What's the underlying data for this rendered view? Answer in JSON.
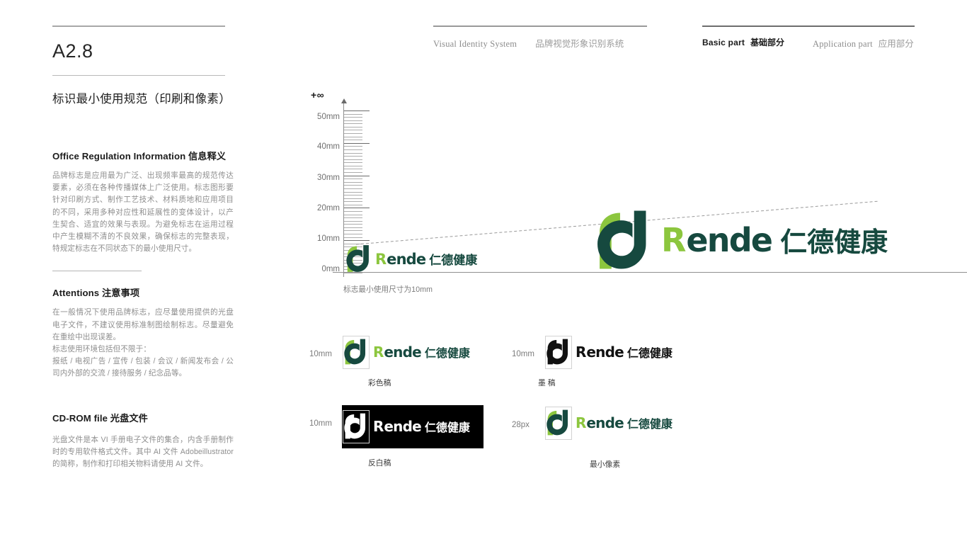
{
  "header": {
    "left_en": "Visual Identity System",
    "left_cn": "品牌视觉形象识别系统",
    "right_en_active": "Basic part",
    "right_cn_active": "基础部分",
    "right_en_inactive": "Application part",
    "right_cn_inactive": "应用部分"
  },
  "page": {
    "code": "A2.8",
    "subtitle": "标识最小使用规范（印刷和像素）"
  },
  "sections": [
    {
      "heading": "Office Regulation Information 信息释义",
      "body": "品牌标志是应用最为广泛、出现频率最高的规范传达要素，必须在各种传播媒体上广泛使用。标志图形要针对印刷方式、制作工艺技术、材料质地和应用项目的不同，采用多种对应性和延展性的变体设计，以产生契合、适宜的效果与表现。为避免标志在运用过程中产生模糊不清的不良效果，确保标志的完整表现，特规定标志在不同状态下的最小使用尺寸。"
    },
    {
      "heading": "Attentions 注意事项",
      "body": "在一般情况下使用品牌标志，应尽量使用提供的光盘电子文件，不建议使用标准制图绘制标志。尽量避免在重绘中出现误差。\n标志使用环境包括但不限于：\n报纸 / 电视广告 / 宣传 / 包装 / 会议 / 新闻发布会 / 公司内外部的交流 / 接待服务 / 纪念品等。"
    },
    {
      "heading": "CD-ROM file 光盘文件",
      "body": "光盘文件是本 VI 手册电子文件的集合，内含手册制作时的专用软件格式文件。其中 AI 文件 Adobeillustrator 的简称，制作和打印相关物料请使用 AI 文件。"
    }
  ],
  "chart_data": {
    "type": "scatter",
    "title": "",
    "xlabel": "+∞",
    "ylabel": "+∞",
    "y_ticks": [
      "50mm",
      "40mm",
      "30mm",
      "20mm",
      "10mm",
      "0mm"
    ],
    "y_tick_values": [
      50,
      40,
      30,
      20,
      10,
      0
    ],
    "ylim": [
      0,
      50
    ],
    "unit": "mm",
    "ruler_major_interval_mm": 10,
    "ruler_minor_interval_mm": 1,
    "axis_top_label": "+∞",
    "axis_right_label": "+∞",
    "caption": "标志最小使用尺寸为10mm",
    "series": [
      {
        "name": "minimum-size-logo",
        "size_mm": 10,
        "x": 0.06
      },
      {
        "name": "scaled-logo",
        "size_mm": 25,
        "x": 0.62
      }
    ],
    "grid": false,
    "legend": "none"
  },
  "logo": {
    "word_r": "R",
    "word_rest": "ende",
    "word_cn": "仁德健康",
    "color_light": "#8cc63e",
    "color_dark": "#16493f",
    "color_black": "#111111",
    "color_white": "#ffffff"
  },
  "samples": [
    {
      "size_label": "10mm",
      "caption": "彩色稿",
      "variant": "color"
    },
    {
      "size_label": "10mm",
      "caption": "墨 稿",
      "variant": "black"
    },
    {
      "size_label": "10mm",
      "caption": "反白稿",
      "variant": "reversed"
    },
    {
      "size_label": "28px",
      "caption": "最小像素",
      "variant": "pixel"
    }
  ]
}
